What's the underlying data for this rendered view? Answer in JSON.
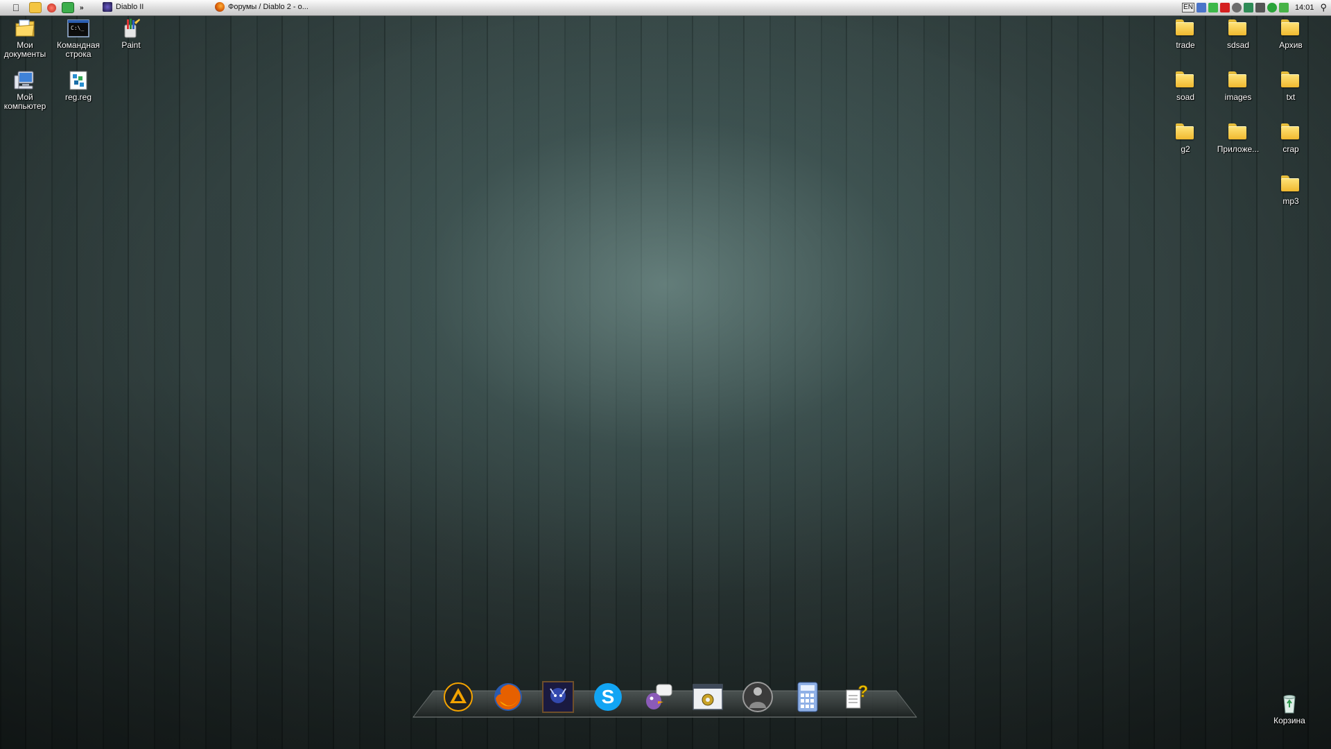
{
  "menubar": {
    "apple_icon": "apple-icon",
    "quick_launch": [
      "folder-icon",
      "power-icon",
      "app-icon"
    ],
    "chevron": "»",
    "tasks": [
      {
        "label": "Diablo II",
        "icon": "diablo-icon"
      },
      {
        "label": "Форумы / Diablo 2 - о...",
        "icon": "firefox-icon"
      }
    ],
    "tray": {
      "language": "EN",
      "clock": "14:01",
      "icons": [
        "network-icon",
        "shield-icon",
        "antivirus-icon",
        "globe-icon",
        "volume-icon",
        "update-icon",
        "status-icon",
        "spotlight-icon"
      ]
    }
  },
  "desktop": {
    "left_icons": [
      {
        "label": "Мои документы",
        "icon": "my-documents-icon"
      },
      {
        "label": "Командная строка",
        "icon": "command-prompt-icon"
      },
      {
        "label": "Paint",
        "icon": "paint-icon"
      },
      {
        "label": "Мой компьютер",
        "icon": "my-computer-icon"
      },
      {
        "label": "reg.reg",
        "icon": "registry-file-icon"
      }
    ],
    "right_folders": [
      {
        "label": "trade"
      },
      {
        "label": "sdsad"
      },
      {
        "label": "Архив"
      },
      {
        "label": "soad"
      },
      {
        "label": "images"
      },
      {
        "label": "txt"
      },
      {
        "label": "g2"
      },
      {
        "label": "Приложе..."
      },
      {
        "label": "crap"
      },
      {
        "label": "mp3"
      }
    ],
    "recycle_bin": {
      "label": "Корзина",
      "icon": "recycle-bin-icon"
    }
  },
  "dock": {
    "items": [
      "aimp-icon",
      "firefox-icon",
      "diablo-icon",
      "skype-icon",
      "pidgin-icon",
      "control-panel-icon",
      "game-character-icon",
      "calculator-icon",
      "help-icon"
    ]
  },
  "colors": {
    "folder": "#f0b92f",
    "menubar": "#d9d9d9",
    "wallpaper": "#2f3f3e"
  }
}
